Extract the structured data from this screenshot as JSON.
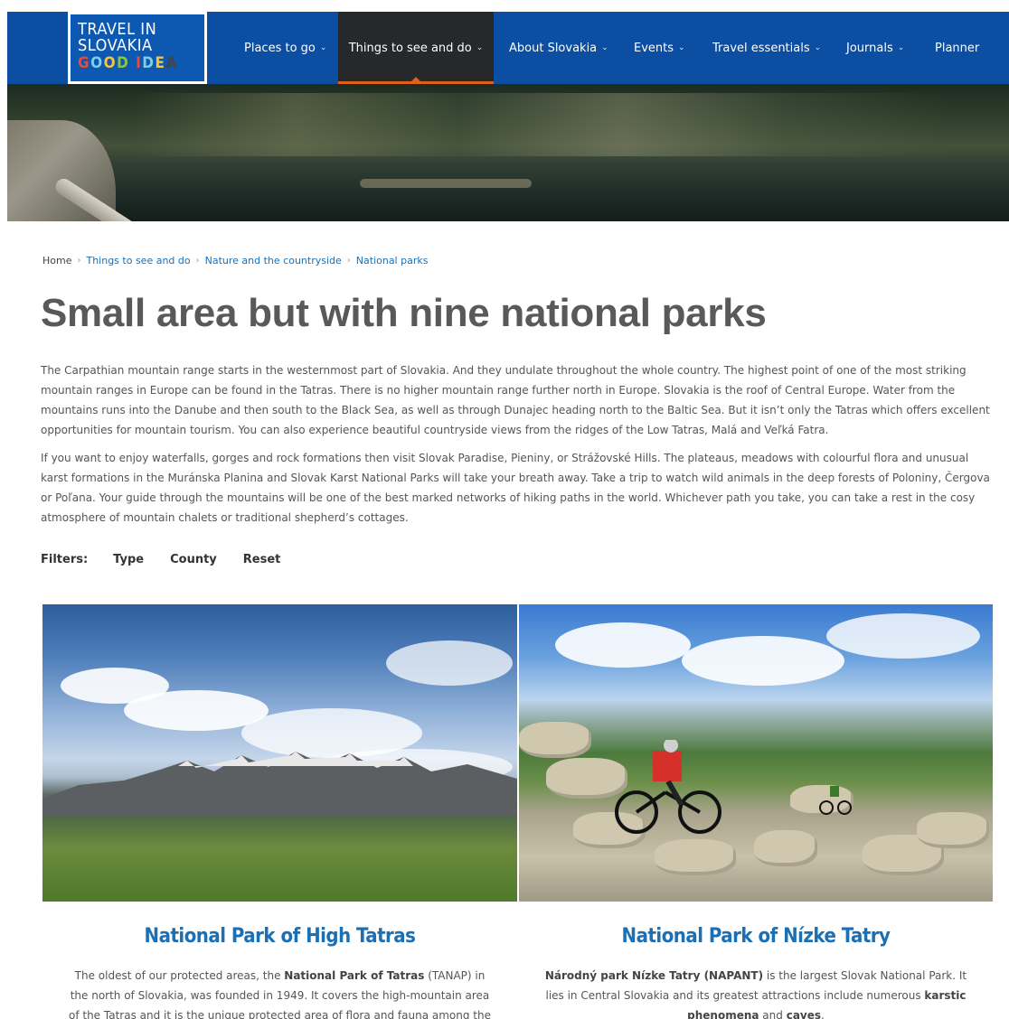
{
  "logo": {
    "line1": "TRAVEL IN",
    "line2": "SLOVAKIA",
    "line3": [
      "G",
      "O",
      "O",
      "D",
      " ",
      "I",
      "D",
      "E",
      "A"
    ]
  },
  "nav": {
    "items": [
      {
        "label": "Places to go",
        "chevron": "⌄"
      },
      {
        "label": "Things to see and do",
        "chevron": "⌄",
        "active": true
      },
      {
        "label": "About Slovakia",
        "chevron": "⌄"
      },
      {
        "label": "Events",
        "chevron": "⌄"
      },
      {
        "label": "Travel essentials",
        "chevron": "⌄"
      },
      {
        "label": "Journals",
        "chevron": "⌄"
      },
      {
        "label": "Planner"
      }
    ]
  },
  "breadcrumb": [
    "Home",
    "Things to see and do",
    "Nature and the countryside",
    "National parks"
  ],
  "breadcrumb_sep": "›",
  "page_title": "Small area but with nine national parks",
  "intro": {
    "p1": "The Carpathian mountain range starts in the westernmost part of Slovakia. And they undulate throughout the whole country. The highest point of one of the most striking mountain ranges in Europe can be found in the Tatras. There is no higher mountain range further north in Europe. Slovakia is the roof of Central Europe. Water from the mountains runs into the Danube and then south to the Black Sea, as well as through Dunajec heading north to the Baltic Sea. But it isn’t only the Tatras which offers excellent opportunities for mountain tourism. You can also experience beautiful countryside views from the ridges of the Low Tatras, Malá and Veľká Fatra.",
    "p2": "If you want to enjoy waterfalls, gorges and rock formations then visit Slovak Paradise, Pieniny, or Strážovské Hills. The plateaus, meadows with colourful flora and unusual karst formations in the Muránska Planina and Slovak Karst National Parks will take your breath away. Take a trip to watch wild animals in the deep forests of Poloniny, Čergova or Poľana. Your guide through the mountains will be one of the best marked networks of hiking paths in the world. Whichever path you take, you can take a rest in the cosy atmosphere of mountain chalets or traditional shepherd’s cottages."
  },
  "filters": {
    "label": "Filters:",
    "type": "Type",
    "county": "County",
    "reset": "Reset"
  },
  "cards": [
    {
      "title": "National Park of High Tatras",
      "text_a": "The oldest of our protected areas, the ",
      "text_b": "National Park of Tatras",
      "text_c": " (TANAP) in the north of Slovakia, was founded in 1949. It covers the high-mountain area of the Tatras and it is the unique protected area of flora and fauna among the"
    },
    {
      "title": "National Park of Nízke Tatry",
      "text_a": "Národný park Nízke Tatry (NAPANT)",
      "text_b": " is the largest Slovak National Park. It lies in Central Slovakia and its greatest attractions include numerous ",
      "text_c": "karstic phenomena",
      "text_d": " and ",
      "text_e": "caves",
      "text_f": "."
    }
  ],
  "colors": {
    "nav_bg": "#0b4ea2",
    "nav_active": "#26282a",
    "accent": "#e0601a",
    "link": "#1a6fb5"
  }
}
